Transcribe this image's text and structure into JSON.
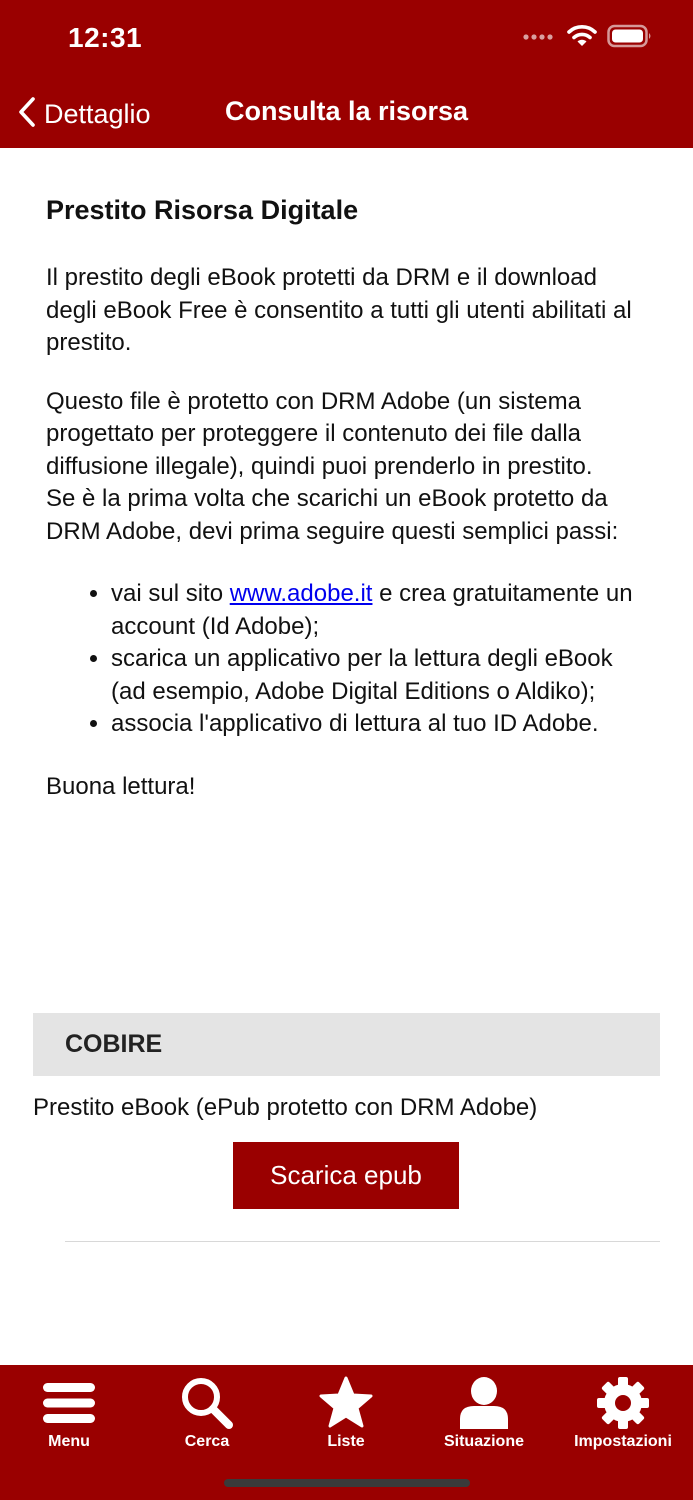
{
  "status_bar": {
    "time": "12:31"
  },
  "nav": {
    "back_label": "Dettaglio",
    "title": "Consulta la risorsa"
  },
  "content": {
    "heading": "Prestito Risorsa Digitale",
    "para1": "Il prestito degli eBook protetti da DRM e il download degli eBook Free è consentito a tutti gli utenti abilitati al prestito.",
    "para2": "Questo file è protetto con DRM Adobe (un sistema progettato per proteggere il contenuto dei file dalla diffusione illegale), quindi puoi prenderlo in prestito.",
    "para3": "Se è la prima volta che scarichi un eBook protetto da DRM Adobe, devi prima seguire questi semplici passi:",
    "steps": {
      "step1_before": "vai sul sito ",
      "step1_link": "www.adobe.it",
      "step1_after": " e crea gratuitamente un account (Id Adobe);",
      "step2": "scarica un applicativo per la lettura degli eBook (ad esempio, Adobe Digital Editions o Aldiko);",
      "step3": "associa l'applicativo di lettura al tuo ID Adobe."
    },
    "closing": "Buona lettura!"
  },
  "section": {
    "title": "COBIRE",
    "loan_type": "Prestito eBook (ePub protetto con DRM Adobe)",
    "download_label": "Scarica epub"
  },
  "tabbar": {
    "items": [
      {
        "label": "Menu",
        "icon": "menu-icon"
      },
      {
        "label": "Cerca",
        "icon": "search-icon"
      },
      {
        "label": "Liste",
        "icon": "star-icon"
      },
      {
        "label": "Situazione",
        "icon": "person-icon"
      },
      {
        "label": "Impostazioni",
        "icon": "gear-icon"
      }
    ]
  },
  "colors": {
    "brand": "#9a0000",
    "section_bg": "#e4e4e4",
    "link": "#0000ee"
  }
}
